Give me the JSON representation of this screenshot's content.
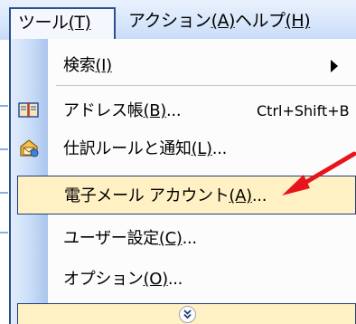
{
  "menubar": {
    "tools": {
      "text": "ツール",
      "key": "(T)"
    },
    "action": {
      "text": "アクション",
      "key": "(A)"
    },
    "help": {
      "text": "ヘルプ",
      "key": "(H)"
    }
  },
  "menu": {
    "items": [
      {
        "text": "検索",
        "key": "(I)",
        "shortcut": "",
        "icon": "",
        "submenu": true
      },
      {
        "text": "アドレス帳",
        "key": "(B)",
        "suffix": "...",
        "shortcut": "Ctrl+Shift+B",
        "icon": "address-book-icon"
      },
      {
        "text": "仕訳ルールと通知",
        "key": "(L)",
        "suffix": "...",
        "shortcut": "",
        "icon": "rules-icon"
      },
      {
        "text": "電子メール アカウント",
        "key": "(A)",
        "suffix": "...",
        "shortcut": "",
        "icon": "",
        "highlighted": true
      },
      {
        "text": "ユーザー設定",
        "key": "(C)",
        "suffix": "...",
        "shortcut": "",
        "icon": ""
      },
      {
        "text": "オプション",
        "key": "(O)",
        "suffix": "...",
        "shortcut": "",
        "icon": ""
      }
    ],
    "expand_icon": "double-chevron-down-icon"
  },
  "colors": {
    "highlight_fill": "#fff1c3",
    "highlight_border": "#1f3f7a",
    "pointer": "#e8141c"
  }
}
